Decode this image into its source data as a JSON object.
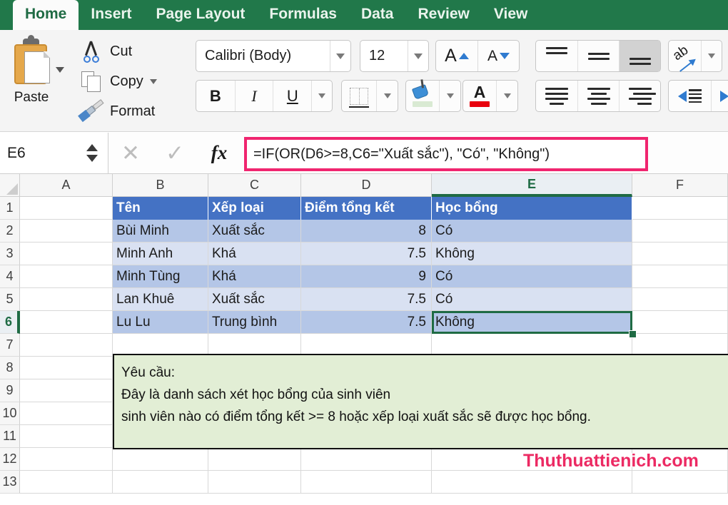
{
  "ribbon": {
    "tabs": [
      {
        "label": "Home",
        "active": true
      },
      {
        "label": "Insert",
        "active": false
      },
      {
        "label": "Page Layout",
        "active": false
      },
      {
        "label": "Formulas",
        "active": false
      },
      {
        "label": "Data",
        "active": false
      },
      {
        "label": "Review",
        "active": false
      },
      {
        "label": "View",
        "active": false
      }
    ],
    "clipboard": {
      "paste_label": "Paste",
      "cut_label": "Cut",
      "copy_label": "Copy",
      "format_label": "Format"
    },
    "font": {
      "font_name": "Calibri (Body)",
      "font_size": "12",
      "grow_label": "A",
      "shrink_label": "A",
      "bold_label": "B",
      "italic_label": "I",
      "underline_label": "U",
      "font_color_label": "A",
      "font_color_swatch": "#e8000d",
      "fill_color_swatch": "#d9ead3"
    },
    "alignment": {
      "orientation_label": "ab"
    }
  },
  "formula_bar": {
    "name_box": "E6",
    "cancel_icon": "✕",
    "enter_icon": "✓",
    "function_icon": "fx",
    "formula": "=IF(OR(D6>=8,C6=\"Xuất sắc\"), \"Có\", \"Không\")"
  },
  "sheet": {
    "columns": [
      "A",
      "B",
      "C",
      "D",
      "E",
      "F"
    ],
    "selected_column": "E",
    "rows": [
      "1",
      "2",
      "3",
      "4",
      "5",
      "6",
      "7",
      "8",
      "9",
      "10",
      "11",
      "12",
      "13"
    ],
    "selected_row": "6",
    "selected_cell": "E6",
    "header_fill": "#4472c4",
    "band_dark": "#b4c6e7",
    "band_light": "#d9e1f2",
    "table": {
      "headers": [
        "Tên",
        "Xếp loại",
        "Điểm tổng kết",
        "Học bổng"
      ],
      "rows": [
        {
          "ten": "Bùi Minh",
          "xeploai": "Xuất sắc",
          "diem": "8",
          "hocbong": "Có"
        },
        {
          "ten": "Minh Anh",
          "xeploai": "Khá",
          "diem": "7.5",
          "hocbong": "Không"
        },
        {
          "ten": "Minh Tùng",
          "xeploai": "Khá",
          "diem": "9",
          "hocbong": "Có"
        },
        {
          "ten": "Lan Khuê",
          "xeploai": "Xuất sắc",
          "diem": "7.5",
          "hocbong": "Có"
        },
        {
          "ten": "Lu Lu",
          "xeploai": "Trung bình",
          "diem": "7.5",
          "hocbong": "Không"
        }
      ]
    },
    "note": {
      "line1": "Yêu cầu:",
      "line2": "Đây là danh sách xét học bổng của sinh viên",
      "line3": "sinh viên nào có điểm tổng kết >= 8 hoặc xếp loại xuất sắc sẽ được học bổng.",
      "fill": "#e2eed5"
    }
  },
  "watermark": "Thuthuattienich.com"
}
